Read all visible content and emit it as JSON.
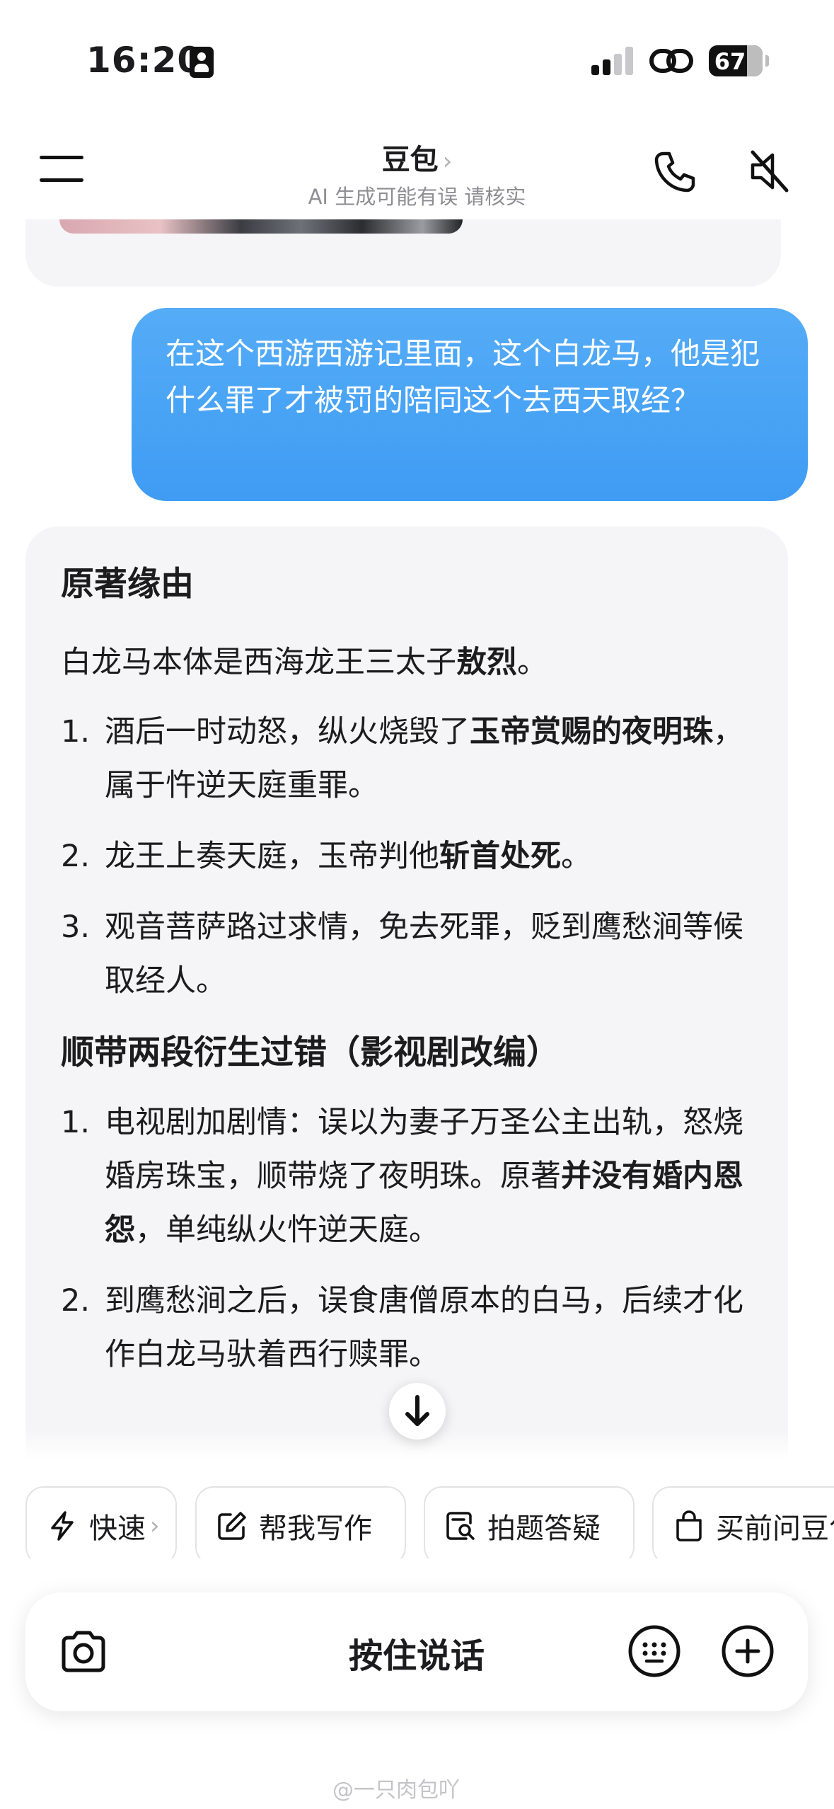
{
  "status_bar": {
    "time": "16:20",
    "battery": "67"
  },
  "header": {
    "title": "豆包",
    "title_chevron": "›",
    "subtitle": "AI 生成可能有误 请核实"
  },
  "chat": {
    "user_message": "在这个西游西游记里面，这个白龙马，他是犯什么罪了才被罚的陪同这个去西天取经？",
    "ai": {
      "heading1": "原著缘由",
      "intro": [
        "白龙马本体是西海龙王三太子",
        "敖烈",
        "。"
      ],
      "list1": [
        {
          "num": "1.",
          "parts": [
            "酒后一时动怒，纵火烧毁了",
            "玉帝赏赐的夜明珠",
            "，属于忤逆天庭重罪。"
          ]
        },
        {
          "num": "2.",
          "parts": [
            "龙王上奏天庭，玉帝判他",
            "斩首处死",
            "。"
          ]
        },
        {
          "num": "3.",
          "parts": [
            "观音菩萨路过求情，免去死罪，贬到鹰愁涧等候取经人。",
            "",
            ""
          ]
        }
      ],
      "heading2": "顺带两段衍生过错（影视剧改编）",
      "list2": [
        {
          "num": "1.",
          "parts": [
            "电视剧加剧情：误以为妻子万圣公主出轨，怒烧婚房珠宝，顺带烧了夜明珠。原著",
            "并没有婚内恩怨",
            "，单纯纵火忤逆天庭。"
          ]
        },
        {
          "num": "2.",
          "parts": [
            "到鹰愁涧之后，误食唐僧原本的白马，后续才化作白龙马驮着西行赎罪。",
            "",
            ""
          ]
        }
      ]
    }
  },
  "chips": [
    {
      "label": "快速",
      "icon": "lightning-icon"
    },
    {
      "label": "帮我写作",
      "icon": "edit-icon"
    },
    {
      "label": "拍题答疑",
      "icon": "scan-question-icon"
    },
    {
      "label": "买前问豆包",
      "icon": "shopping-bag-icon"
    }
  ],
  "input": {
    "hold_to_talk": "按住说话"
  },
  "watermark": "@一只肉包吖",
  "colors": {
    "user_bubble": "#4fa7f6",
    "card_bg": "#f5f5f7"
  }
}
